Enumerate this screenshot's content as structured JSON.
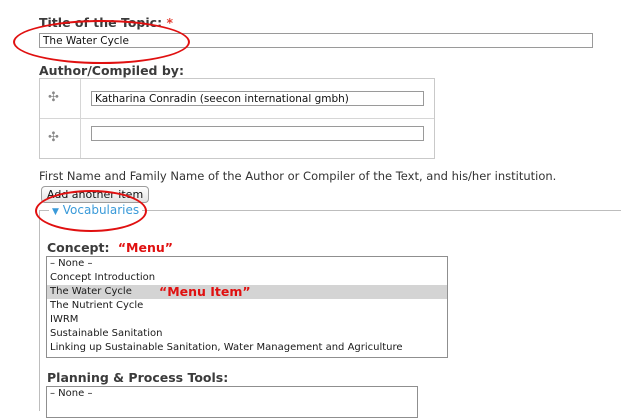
{
  "title_field": {
    "label": "Title of the Topic:",
    "required_mark": "*",
    "value": "The Water Cycle"
  },
  "author_field": {
    "label": "Author/Compiled by:",
    "rows": [
      {
        "value": "Katharina Conradin (seecon international gmbh)"
      },
      {
        "value": ""
      }
    ],
    "description": "First Name and Family Name of the Author or Compiler of the Text, and his/her institution.",
    "add_button": "Add another item"
  },
  "vocabularies": {
    "toggle_icon": "triangle-down-icon",
    "label": "Vocabularies"
  },
  "concept": {
    "label": "Concept:",
    "annotation": "“Menu”",
    "item_annotation": "“Menu Item”",
    "options": [
      {
        "label": "– None –",
        "selected": false
      },
      {
        "label": "Concept Introduction",
        "selected": false
      },
      {
        "label": "The Water Cycle",
        "selected": true
      },
      {
        "label": "The Nutrient Cycle",
        "selected": false
      },
      {
        "label": "IWRM",
        "selected": false
      },
      {
        "label": "Sustainable Sanitation",
        "selected": false
      },
      {
        "label": "Linking up Sustainable Sanitation, Water Management and Agriculture",
        "selected": false
      }
    ]
  },
  "planning": {
    "label": "Planning & Process Tools:",
    "options": [
      {
        "label": "– None –",
        "selected": false
      }
    ]
  },
  "colors": {
    "annotation": "#e01010",
    "link": "#3a9ad9",
    "selected_row": "#d4d4d4"
  }
}
